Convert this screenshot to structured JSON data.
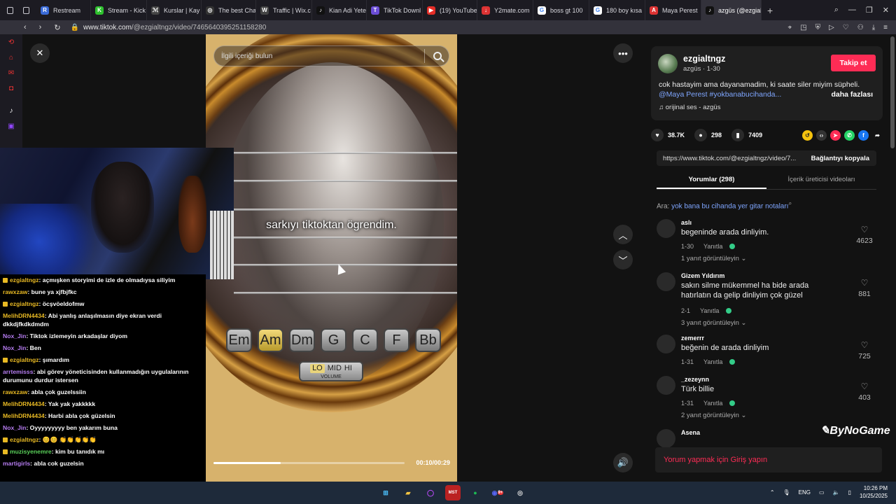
{
  "tabs": [
    {
      "label": "Restream",
      "icon": "restream-icon",
      "color": "#3a6bd8",
      "glyph": "R"
    },
    {
      "label": "Stream - Kick",
      "icon": "kick-icon",
      "color": "#2ec12e",
      "glyph": "K"
    },
    {
      "label": "Kurslar | Kay",
      "icon": "kurslar-icon",
      "color": "#444444",
      "glyph": "ℳ"
    },
    {
      "label": "The best Cha",
      "icon": "chatgpt-icon",
      "color": "#333333",
      "glyph": "◎"
    },
    {
      "label": "Traffic | Wix.c",
      "icon": "wix-icon",
      "color": "#444444",
      "glyph": "W"
    },
    {
      "label": "Kian Adi Yete",
      "icon": "tiktok-icon",
      "color": "#111111",
      "glyph": "♪"
    },
    {
      "label": "TikTok Downl",
      "icon": "tiktok-download-icon",
      "color": "#6b4dd6",
      "glyph": "T"
    },
    {
      "label": "(19) YouTube",
      "icon": "youtube-icon",
      "color": "#e52d27",
      "glyph": "▶"
    },
    {
      "label": "Y2mate.com",
      "icon": "y2mate-icon",
      "color": "#d33",
      "glyph": "↓"
    },
    {
      "label": "boss gt 100",
      "icon": "google-icon",
      "color": "#ffffff",
      "glyph": "G"
    },
    {
      "label": "180 boy kısa",
      "icon": "google-icon",
      "color": "#ffffff",
      "glyph": "G"
    },
    {
      "label": "Maya Perest",
      "icon": "a-icon",
      "color": "#d33",
      "glyph": "A"
    },
    {
      "label": "azgüs (@ezgialtngz",
      "icon": "tiktok-icon",
      "color": "#111111",
      "glyph": "♪"
    }
  ],
  "address": {
    "host": "www.tiktok.com",
    "path": "/@ezgialtngz/video/7465640395251158280"
  },
  "video": {
    "search_placeholder": "İlgili içeriği bulun",
    "caption": "sarkıyı tiktoktan ögrendim.",
    "chords": [
      "Em",
      "Am",
      "Dm",
      "G",
      "C",
      "F",
      "Bb"
    ],
    "active_chord": 1,
    "volume_options": [
      "LO",
      "MID",
      "HI"
    ],
    "volume_label": "VOLUME",
    "time": "00:10/00:29",
    "progress": 0.35
  },
  "post": {
    "username": "ezgialtngz",
    "subline": "azgüs · 1-30",
    "follow": "Takip et",
    "description": "cok hastayim ama dayanamadim, ki saate siler miyim süpheli.",
    "tags": "@Maya Perest #yokbanabucihanda...",
    "more": "daha fazlası",
    "sound": "orijinal ses - azgüs",
    "likes": "38.7K",
    "comments": "298",
    "saves": "7409",
    "link": "https://www.tiktok.com/@ezgialtngz/video/7...",
    "copy": "Bağlantıyı kopyala",
    "tab_comments": "Yorumlar (298)",
    "tab_creator": "İçerik üreticisi videoları",
    "search_prefix": "Ara:",
    "search_query": "yok bana bu cihanda yer gitar notaları",
    "login": "Yorum yapmak için Giriş yapın"
  },
  "comments": [
    {
      "name": "aslı",
      "text": "begeninde arada dinliyim.",
      "date": "1-30",
      "reply": "Yanıtla",
      "likes": "4623",
      "replies": "1 yanıt görüntüleyin"
    },
    {
      "name": "Gizem Yıldırım",
      "text": "sakın silme mükemmel ha bide arada hatırlatın da gelip dinliyim çok güzel",
      "date": "2-1",
      "reply": "Yanıtla",
      "likes": "881",
      "replies": "3 yanıt görüntüleyin"
    },
    {
      "name": "zemerrr",
      "text": "beğenin de arada dinliyim",
      "date": "1-31",
      "reply": "Yanıtla",
      "likes": "725",
      "replies": ""
    },
    {
      "name": "_zezeynn",
      "text": "Türk billie",
      "date": "1-31",
      "reply": "Yanıtla",
      "likes": "403",
      "replies": "2 yanıt görüntüleyin"
    },
    {
      "name": "Asena",
      "text": "",
      "date": "",
      "reply": "",
      "likes": "",
      "replies": ""
    }
  ],
  "chat": [
    {
      "user": "ezgialtngz",
      "color": "#e8b923",
      "badge": true,
      "text": ": açmışken storyimi de izle de olmadıysa siliyim"
    },
    {
      "user": "rawxzaw",
      "color": "#e8b923",
      "badge": false,
      "text": ": bune ya xjfbjfkc"
    },
    {
      "user": "ezgialtngz",
      "color": "#e8b923",
      "badge": true,
      "text": ": öcşvöeldofmw"
    },
    {
      "user": "MelihDRN4434",
      "color": "#e8b923",
      "badge": false,
      "text": ": Abi yanlış anlaşılmasın diye ekran verdi dkkdjfkdkdmdm"
    },
    {
      "user": "Nox_Jin",
      "color": "#b57cf0",
      "badge": false,
      "text": ": Tiktok izlemeyin arkadaşlar diyom"
    },
    {
      "user": "Nox_Jin",
      "color": "#b57cf0",
      "badge": false,
      "text": ": Ben"
    },
    {
      "user": "ezgialtngz",
      "color": "#e8b923",
      "badge": true,
      "text": ": şımardım"
    },
    {
      "user": "arrtemisss",
      "color": "#b57cf0",
      "badge": false,
      "text": ": abi görev yöneticisinden kullanmadığın uygulalarının durumunu durdur istersen"
    },
    {
      "user": "rawxzaw",
      "color": "#e8b923",
      "badge": false,
      "text": ": abla çok guzelssiin"
    },
    {
      "user": "MelihDRN4434",
      "color": "#e8b923",
      "badge": false,
      "text": ": Yak yak yakkkkk"
    },
    {
      "user": "MelihDRN4434",
      "color": "#e8b923",
      "badge": false,
      "text": ": Harbi abla çok güzelsin"
    },
    {
      "user": "Nox_Jin",
      "color": "#b57cf0",
      "badge": false,
      "text": ": Oyyyyyyyyy ben yakarım buna"
    },
    {
      "user": "ezgialtngz",
      "color": "#e8b923",
      "badge": true,
      "text": ": 😊😊 👏👏👏👏👏"
    },
    {
      "user": "muzisyenemre",
      "color": "#5ad15a",
      "badge": true,
      "text": ": kim bu tanıdık mı"
    },
    {
      "user": "martigirls",
      "color": "#b57cf0",
      "badge": false,
      "text": ": abla cok guzelsin"
    }
  ],
  "taskbar": {
    "lang": "ENG",
    "time": "10:26 PM",
    "date": "10/25/2025",
    "discord_badge": "9+"
  },
  "watermark": "ByNoGame"
}
